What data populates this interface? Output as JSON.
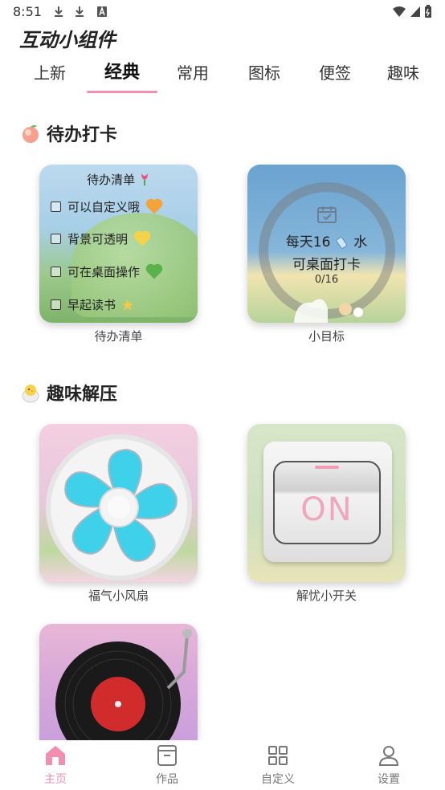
{
  "status_bar": {
    "time": "8:51"
  },
  "app": {
    "title": "互动小组件"
  },
  "tabs": [
    {
      "label": "上新"
    },
    {
      "label": "经典"
    },
    {
      "label": "常用"
    },
    {
      "label": "图标"
    },
    {
      "label": "便签"
    },
    {
      "label": "趣味"
    }
  ],
  "sections": {
    "todo": {
      "title": "待办打卡",
      "icon": "peach-icon"
    },
    "fun": {
      "title": "趣味解压",
      "icon": "chick-icon"
    }
  },
  "widgets": {
    "todo_list": {
      "caption": "待办清单",
      "title": "待办清单",
      "items": [
        {
          "text": "可以自定义哦",
          "heart_color": "#f5a23a"
        },
        {
          "text": "背景可透明",
          "heart_color": "#f4d24a"
        },
        {
          "text": "可在桌面操作",
          "heart_color": "#5ab34a"
        },
        {
          "text": "早起读书",
          "heart_color": "#f4d24a"
        }
      ]
    },
    "goal": {
      "caption": "小目标",
      "line1": "每天16",
      "line1_suffix": "水",
      "line2": "可桌面打卡",
      "progress": "0/16"
    },
    "fan": {
      "caption": "福气小风扇"
    },
    "switch": {
      "caption": "解忧小开关",
      "state_label": "ON"
    },
    "record": {
      "caption": ""
    }
  },
  "bottom_nav": [
    {
      "label": "主页",
      "icon": "home-icon",
      "active": true
    },
    {
      "label": "作品",
      "icon": "works-icon",
      "active": false
    },
    {
      "label": "自定义",
      "icon": "grid-icon",
      "active": false
    },
    {
      "label": "设置",
      "icon": "user-icon",
      "active": false
    }
  ],
  "colors": {
    "accent": "#f28fb1",
    "tab_indicator": "#f58fb0"
  }
}
